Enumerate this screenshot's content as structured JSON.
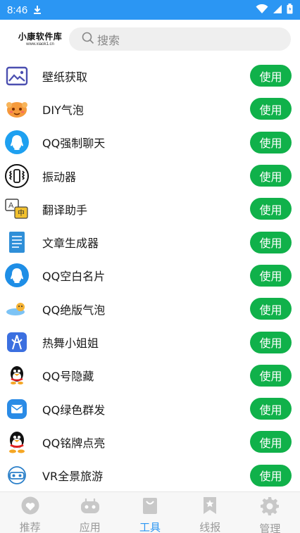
{
  "status_bar": {
    "time": "8:46"
  },
  "header": {
    "logo_main": "小康软件库",
    "logo_sub": "www.xiaok1.cn",
    "search_placeholder": "搜索"
  },
  "colors": {
    "accent": "#2b96f3",
    "button_green": "#10b14a",
    "tab_inactive": "#9a9a9a"
  },
  "tools": [
    {
      "label": "壁纸获取",
      "icon": "wallpaper-icon",
      "button": "使用"
    },
    {
      "label": "DIY气泡",
      "icon": "bubble-face-icon",
      "button": "使用"
    },
    {
      "label": "QQ强制聊天",
      "icon": "qq-chat-icon",
      "button": "使用"
    },
    {
      "label": "振动器",
      "icon": "vibrator-icon",
      "button": "使用"
    },
    {
      "label": "翻译助手",
      "icon": "translate-icon",
      "button": "使用"
    },
    {
      "label": "文章生成器",
      "icon": "document-icon",
      "button": "使用"
    },
    {
      "label": "QQ空白名片",
      "icon": "qq-card-icon",
      "button": "使用"
    },
    {
      "label": "QQ绝版气泡",
      "icon": "bubble-icon",
      "button": "使用"
    },
    {
      "label": "热舞小姐姐",
      "icon": "dance-icon",
      "button": "使用"
    },
    {
      "label": "QQ号隐藏",
      "icon": "qq-penguin-icon",
      "button": "使用"
    },
    {
      "label": "QQ绿色群发",
      "icon": "mail-icon",
      "button": "使用"
    },
    {
      "label": "QQ铭牌点亮",
      "icon": "qq-penguin-badge-icon",
      "button": "使用"
    },
    {
      "label": "VR全景旅游",
      "icon": "vr-icon",
      "button": "使用"
    }
  ],
  "tabs": [
    {
      "label": "推荐",
      "icon": "heart-icon",
      "active": false
    },
    {
      "label": "应用",
      "icon": "gamepad-icon",
      "active": false
    },
    {
      "label": "工具",
      "icon": "bag-icon",
      "active": true
    },
    {
      "label": "线报",
      "icon": "bookmark-star-icon",
      "active": false
    },
    {
      "label": "管理",
      "icon": "gear-icon",
      "active": false
    }
  ]
}
